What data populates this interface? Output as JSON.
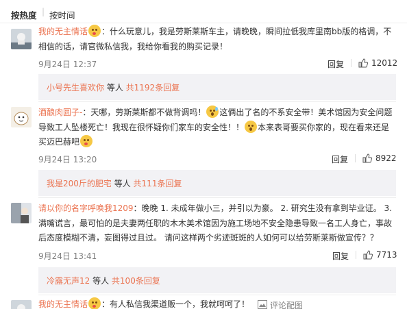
{
  "sort": {
    "hot": "按热度",
    "time": "按时间"
  },
  "comments": [
    {
      "user": "我的无主情话",
      "text_a": "：什么玩意儿，我是劳斯莱斯车主，请晚晚，瞬间拉低我库里南bb版的格调，不相信的话，请官微私信我，我给你看我的购买记录！",
      "time": "9月24日 12:37",
      "reply": "回复",
      "likes": "12012",
      "sub_who": "小号先生喜欢你",
      "sub_mid": " 等人 ",
      "sub_total": "共1192条回复"
    },
    {
      "user": "酒酿肉圆子-",
      "text_a": "：天哪，劳斯莱斯都不做背调吗！",
      "text_b": "这俩出了名的不系安全带！美术馆因为安全问题导致工人坠楼死亡！我现在很怀疑你们家车的安全性！！",
      "text_c": "本来表哥要买你家的，现在看来还是买迈巴赫吧",
      "time": "9月24日 13:20",
      "reply": "回复",
      "likes": "8922",
      "sub_who": "我是200斤的肥宅",
      "sub_mid": " 等人 ",
      "sub_total": "共111条回复"
    },
    {
      "user": "请以你的名字呼唤我1209",
      "text_a": "：晚晚 1. 未成年做小三，并引以为豪。 2. 研究生没有拿到毕业证。 3. 满嘴谎言，最可怕的是夫妻两任职的木木美术馆因为施工场地不安全隐患导致一名工人身亡，事故后态度模糊不清，妄图得过且过。  请问这样两个劣迹斑斑的人如何可以给劳斯莱斯做宣传？？",
      "time": "9月24日 13:41",
      "reply": "回复",
      "likes": "7713",
      "sub_who": "冷露无声12",
      "sub_mid": " 等人 ",
      "sub_total": "共100条回复"
    },
    {
      "user": "我的无主情话",
      "text_a": "：有人私信我渠道贩一个，我就呵呵了！",
      "comment_btn": "评论配图"
    }
  ],
  "colors": {
    "link": "#eb7350",
    "meta": "#808080",
    "subreply_bg": "#f2f2f5"
  }
}
